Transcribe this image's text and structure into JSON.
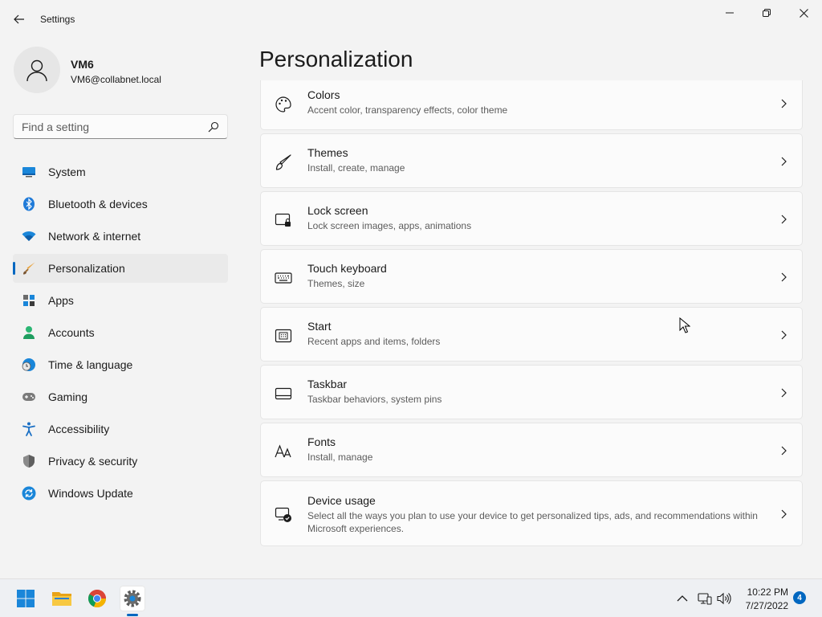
{
  "window": {
    "title": "Settings"
  },
  "profile": {
    "name": "VM6",
    "email": "VM6@collabnet.local"
  },
  "search": {
    "placeholder": "Find a setting",
    "value": ""
  },
  "nav": {
    "selected": "Personalization",
    "items": [
      {
        "label": "System",
        "icon": "monitor-icon"
      },
      {
        "label": "Bluetooth & devices",
        "icon": "bluetooth-icon"
      },
      {
        "label": "Network & internet",
        "icon": "wifi-icon"
      },
      {
        "label": "Personalization",
        "icon": "paintbrush-icon"
      },
      {
        "label": "Apps",
        "icon": "apps-icon"
      },
      {
        "label": "Accounts",
        "icon": "person-icon"
      },
      {
        "label": "Time & language",
        "icon": "globe-clock-icon"
      },
      {
        "label": "Gaming",
        "icon": "gamepad-icon"
      },
      {
        "label": "Accessibility",
        "icon": "accessibility-icon"
      },
      {
        "label": "Privacy & security",
        "icon": "shield-icon"
      },
      {
        "label": "Windows Update",
        "icon": "update-icon"
      }
    ]
  },
  "main": {
    "title": "Personalization",
    "cards": [
      {
        "title": "Colors",
        "subtitle": "Accent color, transparency effects, color theme",
        "icon": "palette-icon"
      },
      {
        "title": "Themes",
        "subtitle": "Install, create, manage",
        "icon": "brush-icon"
      },
      {
        "title": "Lock screen",
        "subtitle": "Lock screen images, apps, animations",
        "icon": "lock-screen-icon"
      },
      {
        "title": "Touch keyboard",
        "subtitle": "Themes, size",
        "icon": "keyboard-icon"
      },
      {
        "title": "Start",
        "subtitle": "Recent apps and items, folders",
        "icon": "start-icon"
      },
      {
        "title": "Taskbar",
        "subtitle": "Taskbar behaviors, system pins",
        "icon": "taskbar-icon"
      },
      {
        "title": "Fonts",
        "subtitle": "Install, manage",
        "icon": "font-icon"
      },
      {
        "title": "Device usage",
        "subtitle": "Select all the ways you plan to use your device to get personalized tips, ads, and recommendations within Microsoft experiences.",
        "icon": "device-usage-icon"
      }
    ]
  },
  "taskbar": {
    "apps": [
      "windows-start-icon",
      "file-explorer-icon",
      "chrome-icon",
      "settings-icon"
    ],
    "tray": [
      "chevron-up-icon",
      "network-icon",
      "volume-icon"
    ],
    "time": "10:22 PM",
    "date": "7/27/2022",
    "notification_count": "4"
  },
  "colors": {
    "accent": "#0067c0",
    "background": "#f3f3f3",
    "card": "#fbfbfb"
  }
}
